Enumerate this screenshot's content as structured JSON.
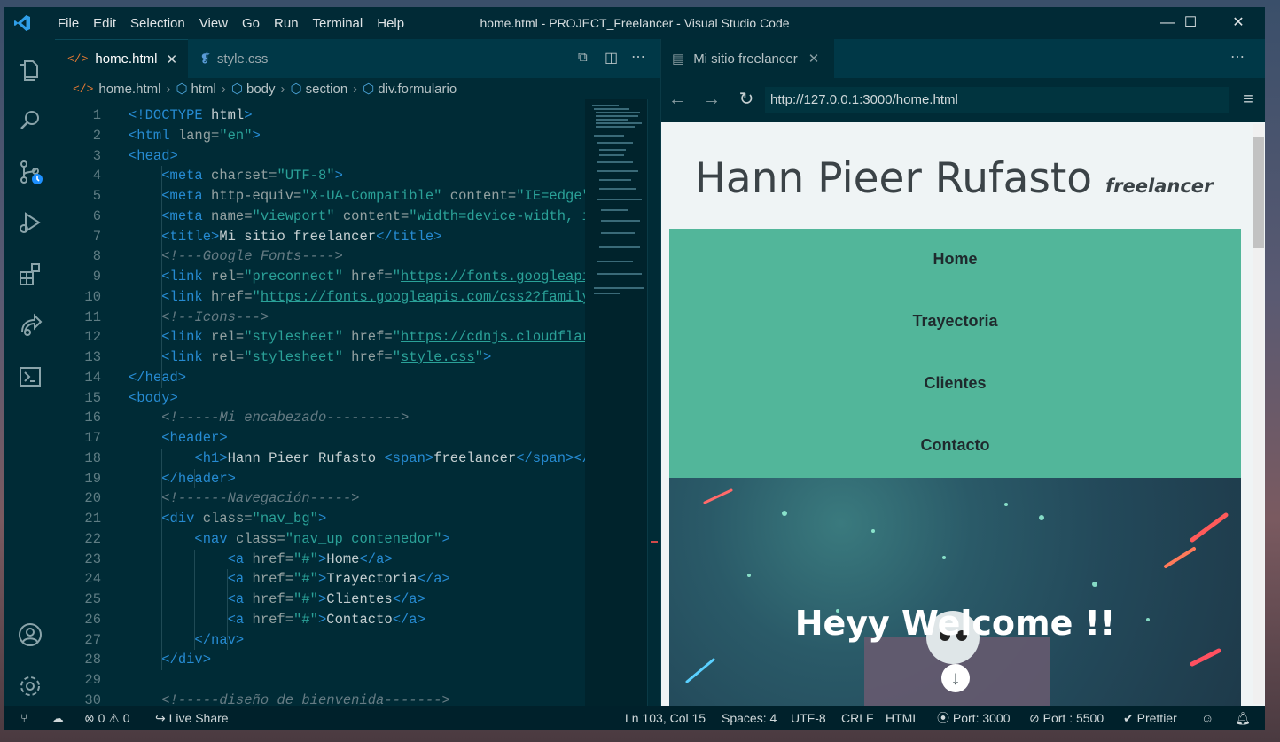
{
  "window": {
    "title": "home.html - PROJECT_Freelancer - Visual Studio Code",
    "menu": [
      "File",
      "Edit",
      "Selection",
      "View",
      "Go",
      "Run",
      "Terminal",
      "Help"
    ],
    "controls": {
      "minimize": "—",
      "maximize": "☐",
      "close": "✕"
    }
  },
  "activity_bar": [
    "explorer-icon",
    "search-icon",
    "source-control-icon",
    "run-debug-icon",
    "extensions-icon",
    "live-share-icon",
    "terminal-icon",
    "account-icon",
    "settings-gear-icon"
  ],
  "editor": {
    "tabs": [
      {
        "label": "home.html",
        "icon": "</>",
        "active": true
      },
      {
        "label": "style.css",
        "icon": "css",
        "active": false
      }
    ],
    "breadcrumb": [
      "home.html",
      "html",
      "body",
      "section",
      "div.formulario"
    ],
    "lines": [
      {
        "n": "1",
        "tokens": [
          [
            "t-tag",
            "<!DOCTYPE "
          ],
          [
            "t-txt",
            "html"
          ],
          [
            "t-tag",
            ">"
          ]
        ]
      },
      {
        "n": "2",
        "tokens": [
          [
            "t-tag",
            "<html "
          ],
          [
            "t-attr",
            "lang="
          ],
          [
            "t-str",
            "\"en\""
          ],
          [
            "t-tag",
            ">"
          ]
        ]
      },
      {
        "n": "3",
        "tokens": [
          [
            "t-tag",
            "<head>"
          ]
        ]
      },
      {
        "n": "4",
        "tokens": [
          [
            "t-txt",
            "    "
          ],
          [
            "t-tag",
            "<meta "
          ],
          [
            "t-attr",
            "charset="
          ],
          [
            "t-str",
            "\"UTF-8\""
          ],
          [
            "t-tag",
            ">"
          ]
        ]
      },
      {
        "n": "5",
        "tokens": [
          [
            "t-txt",
            "    "
          ],
          [
            "t-tag",
            "<meta "
          ],
          [
            "t-attr",
            "http-equiv="
          ],
          [
            "t-str",
            "\"X-UA-Compatible\""
          ],
          [
            "t-attr",
            " content="
          ],
          [
            "t-str",
            "\"IE=edge\""
          ]
        ]
      },
      {
        "n": "6",
        "tokens": [
          [
            "t-txt",
            "    "
          ],
          [
            "t-tag",
            "<meta "
          ],
          [
            "t-attr",
            "name="
          ],
          [
            "t-str",
            "\"viewport\""
          ],
          [
            "t-attr",
            " content="
          ],
          [
            "t-str",
            "\"width=device-width, i"
          ]
        ]
      },
      {
        "n": "7",
        "tokens": [
          [
            "t-txt",
            "    "
          ],
          [
            "t-tag",
            "<title>"
          ],
          [
            "t-txt",
            "Mi sitio freelancer"
          ],
          [
            "t-tag",
            "</title>"
          ]
        ]
      },
      {
        "n": "8",
        "tokens": [
          [
            "t-txt",
            "    "
          ],
          [
            "t-com",
            "<!---Google Fonts---->"
          ]
        ]
      },
      {
        "n": "9",
        "tokens": [
          [
            "t-txt",
            "    "
          ],
          [
            "t-tag",
            "<link "
          ],
          [
            "t-attr",
            "rel="
          ],
          [
            "t-str",
            "\"preconnect\""
          ],
          [
            "t-attr",
            " href="
          ],
          [
            "t-str",
            "\""
          ],
          [
            "t-url",
            "https://fonts.googleapi"
          ]
        ]
      },
      {
        "n": "10",
        "tokens": [
          [
            "t-txt",
            "    "
          ],
          [
            "t-tag",
            "<link "
          ],
          [
            "t-attr",
            "href="
          ],
          [
            "t-str",
            "\""
          ],
          [
            "t-url",
            "https://fonts.googleapis.com/css2?family"
          ]
        ]
      },
      {
        "n": "11",
        "tokens": [
          [
            "t-txt",
            "    "
          ],
          [
            "t-com",
            "<!--Icons--->"
          ]
        ]
      },
      {
        "n": "12",
        "tokens": [
          [
            "t-txt",
            "    "
          ],
          [
            "t-tag",
            "<link "
          ],
          [
            "t-attr",
            "rel="
          ],
          [
            "t-str",
            "\"stylesheet\""
          ],
          [
            "t-attr",
            " href="
          ],
          [
            "t-str",
            "\""
          ],
          [
            "t-url",
            "https://cdnjs.cloudflar"
          ]
        ]
      },
      {
        "n": "13",
        "tokens": [
          [
            "t-txt",
            "    "
          ],
          [
            "t-tag",
            "<link "
          ],
          [
            "t-attr",
            "rel="
          ],
          [
            "t-str",
            "\"stylesheet\""
          ],
          [
            "t-attr",
            " href="
          ],
          [
            "t-str",
            "\""
          ],
          [
            "t-url",
            "style.css"
          ],
          [
            "t-str",
            "\""
          ],
          [
            "t-tag",
            ">"
          ]
        ]
      },
      {
        "n": "14",
        "tokens": [
          [
            "t-tag",
            "</head>"
          ]
        ]
      },
      {
        "n": "15",
        "tokens": [
          [
            "t-tag",
            "<body>"
          ]
        ]
      },
      {
        "n": "16",
        "tokens": [
          [
            "t-txt",
            "    "
          ],
          [
            "t-com",
            "<!-----Mi encabezado--------->"
          ]
        ]
      },
      {
        "n": "17",
        "tokens": [
          [
            "t-txt",
            "    "
          ],
          [
            "t-tag",
            "<header>"
          ]
        ]
      },
      {
        "n": "18",
        "tokens": [
          [
            "t-txt",
            "        "
          ],
          [
            "t-tag",
            "<h1>"
          ],
          [
            "t-txt",
            "Hann Pieer Rufasto "
          ],
          [
            "t-tag",
            "<span>"
          ],
          [
            "t-txt",
            "freelancer"
          ],
          [
            "t-tag",
            "</span></"
          ]
        ]
      },
      {
        "n": "19",
        "tokens": [
          [
            "t-txt",
            "    "
          ],
          [
            "t-tag",
            "</header>"
          ]
        ]
      },
      {
        "n": "20",
        "tokens": [
          [
            "t-txt",
            "    "
          ],
          [
            "t-com",
            "<!------Navegación----->"
          ]
        ]
      },
      {
        "n": "21",
        "tokens": [
          [
            "t-txt",
            "    "
          ],
          [
            "t-tag",
            "<div "
          ],
          [
            "t-attr",
            "class="
          ],
          [
            "t-str",
            "\"nav_bg\""
          ],
          [
            "t-tag",
            ">"
          ]
        ]
      },
      {
        "n": "22",
        "tokens": [
          [
            "t-txt",
            "        "
          ],
          [
            "t-tag",
            "<nav "
          ],
          [
            "t-attr",
            "class="
          ],
          [
            "t-str",
            "\"nav_up contenedor\""
          ],
          [
            "t-tag",
            ">"
          ]
        ]
      },
      {
        "n": "23",
        "tokens": [
          [
            "t-txt",
            "            "
          ],
          [
            "t-tag",
            "<a "
          ],
          [
            "t-attr",
            "href="
          ],
          [
            "t-str",
            "\"#\""
          ],
          [
            "t-tag",
            ">"
          ],
          [
            "t-txt",
            "Home"
          ],
          [
            "t-tag",
            "</a>"
          ]
        ]
      },
      {
        "n": "24",
        "tokens": [
          [
            "t-txt",
            "            "
          ],
          [
            "t-tag",
            "<a "
          ],
          [
            "t-attr",
            "href="
          ],
          [
            "t-str",
            "\"#\""
          ],
          [
            "t-tag",
            ">"
          ],
          [
            "t-txt",
            "Trayectoria"
          ],
          [
            "t-tag",
            "</a>"
          ]
        ]
      },
      {
        "n": "25",
        "tokens": [
          [
            "t-txt",
            "            "
          ],
          [
            "t-tag",
            "<a "
          ],
          [
            "t-attr",
            "href="
          ],
          [
            "t-str",
            "\"#\""
          ],
          [
            "t-tag",
            ">"
          ],
          [
            "t-txt",
            "Clientes"
          ],
          [
            "t-tag",
            "</a>"
          ]
        ]
      },
      {
        "n": "26",
        "tokens": [
          [
            "t-txt",
            "            "
          ],
          [
            "t-tag",
            "<a "
          ],
          [
            "t-attr",
            "href="
          ],
          [
            "t-str",
            "\"#\""
          ],
          [
            "t-tag",
            ">"
          ],
          [
            "t-txt",
            "Contacto"
          ],
          [
            "t-tag",
            "</a>"
          ]
        ]
      },
      {
        "n": "27",
        "tokens": [
          [
            "t-txt",
            "        "
          ],
          [
            "t-tag",
            "</nav>"
          ]
        ]
      },
      {
        "n": "28",
        "tokens": [
          [
            "t-txt",
            "    "
          ],
          [
            "t-tag",
            "</div>"
          ]
        ]
      },
      {
        "n": "29",
        "tokens": []
      },
      {
        "n": "30",
        "tokens": [
          [
            "t-txt",
            "    "
          ],
          [
            "t-com",
            "<!-----diseño de bienvenida------->"
          ]
        ]
      }
    ]
  },
  "browser": {
    "tab_label": "Mi sitio freelancer",
    "url": "http://127.0.0.1:3000/home.html",
    "site": {
      "title": "Hann Pieer Rufasto",
      "subtitle": "freelancer",
      "nav": [
        "Home",
        "Trayectoria",
        "Clientes",
        "Contacto"
      ],
      "hero_title": "Heyy Welcome !!",
      "nav_color": "#52b69a"
    }
  },
  "status_bar": {
    "errors": "0",
    "warnings": "0",
    "live_share": "Live Share",
    "cursor": "Ln 103, Col 15",
    "spaces": "Spaces: 4",
    "encoding": "UTF-8",
    "eol": "CRLF",
    "language": "HTML",
    "port_live": "Port: 3000",
    "port_other": "Port : 5500",
    "prettier": "Prettier"
  },
  "colors": {
    "editor_bg": "#002b36",
    "tag": "#268bd2",
    "string": "#2aa198",
    "comment": "#657b83"
  }
}
